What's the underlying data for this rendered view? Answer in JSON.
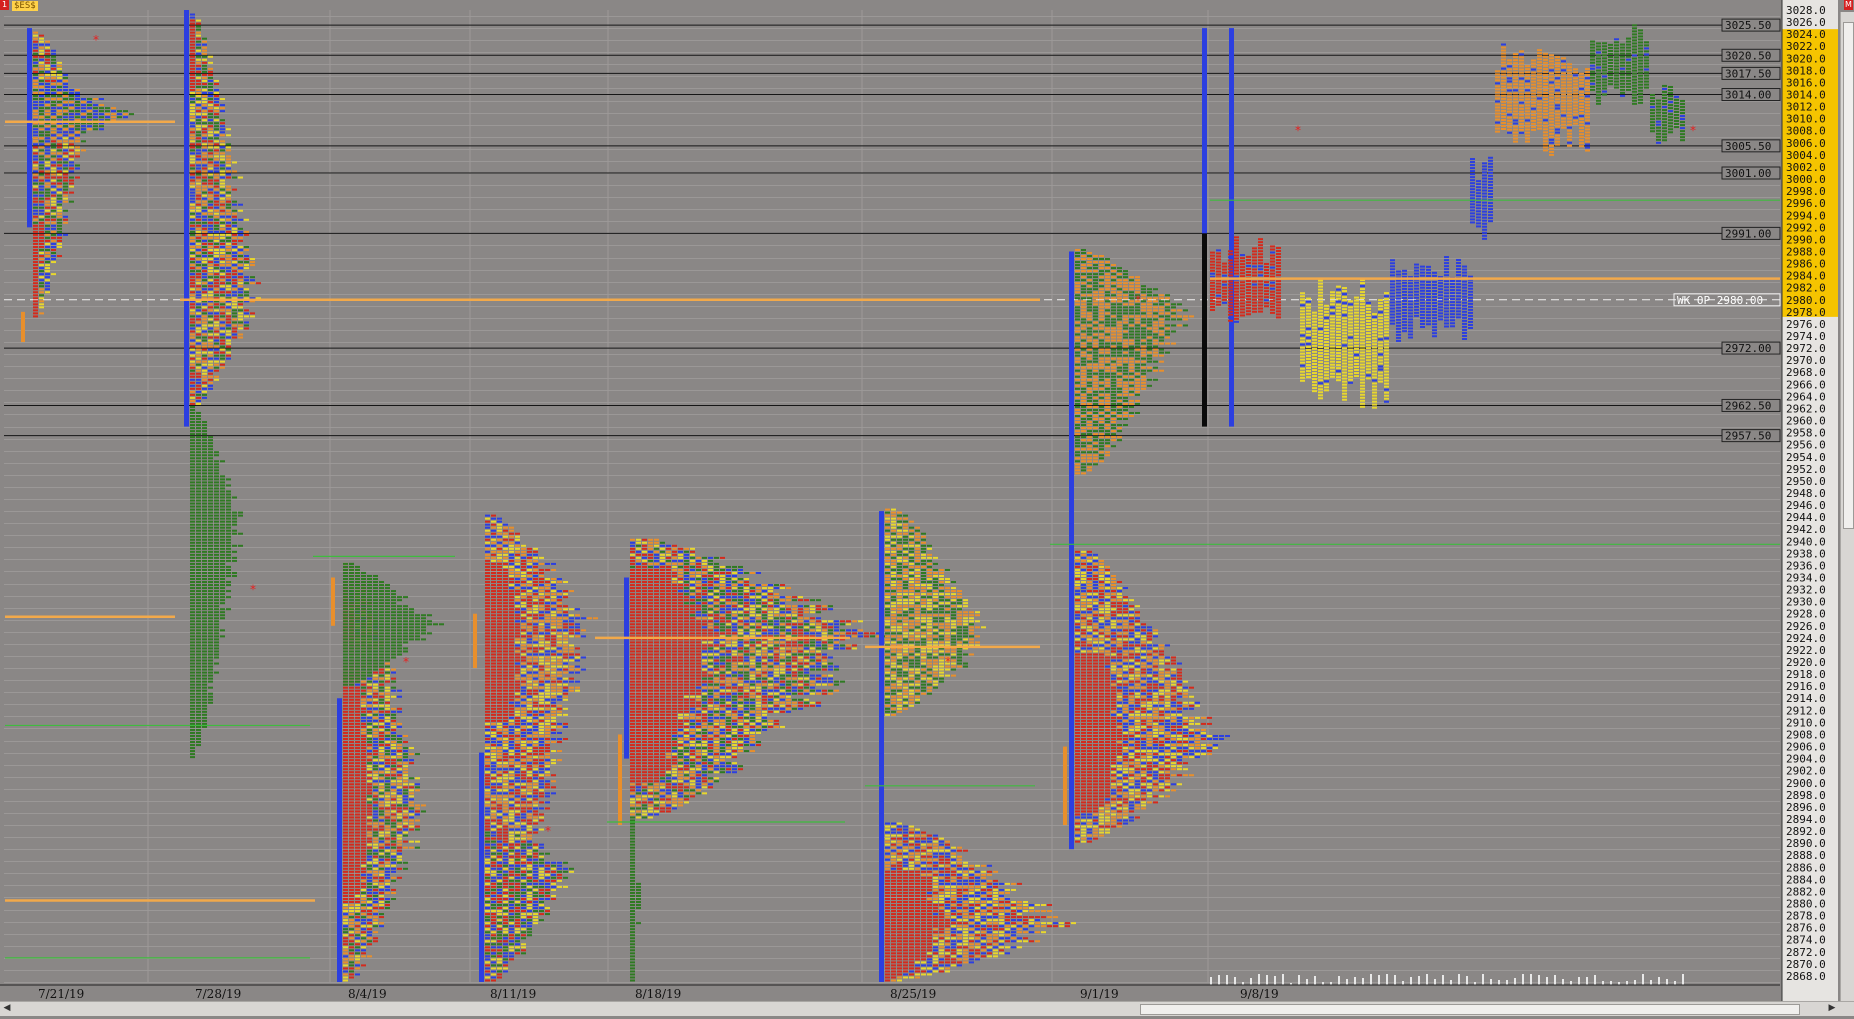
{
  "symbol": "$ES$",
  "corner_left": "1",
  "corner_right": "M",
  "chart_data": {
    "type": "market-profile",
    "x_label_dates": [
      "7/21/19",
      "7/28/19",
      "8/4/19",
      "8/11/19",
      "8/18/19",
      "8/25/19",
      "9/1/19",
      "9/8/19"
    ],
    "y_range": [
      2867,
      3028
    ],
    "y_tick_step": 2,
    "tick": 0.5,
    "row_step": 0.5,
    "colors": {
      "red": "#d42a1c",
      "orange": "#e88f2c",
      "yellow": "#e8d72e",
      "green": "#2f7a22",
      "blue": "#2c3fe0",
      "black": "#0a0a0a",
      "poc": "#f2a94a",
      "level_line": "#161616",
      "green_line": "#3fbb3f",
      "background": "#8a8786",
      "grid": "#9b9897",
      "axis_yellow": "#f5c400",
      "axis_bg": "#e6e4e1"
    },
    "price_labels": [
      {
        "price": 3025.5,
        "label": "3025.50"
      },
      {
        "price": 3020.5,
        "label": "3020.50"
      },
      {
        "price": 3017.5,
        "label": "3017.50"
      },
      {
        "price": 3014.0,
        "label": "3014.00"
      },
      {
        "price": 3005.5,
        "label": "3005.50"
      },
      {
        "price": 3001.0,
        "label": "3001.00"
      },
      {
        "price": 2991.0,
        "label": "2991.00"
      },
      {
        "price": 2980.0,
        "label": "WK OP 2980.00"
      },
      {
        "price": 2972.0,
        "label": "2972.00"
      },
      {
        "price": 2962.5,
        "label": "2962.50"
      },
      {
        "price": 2957.5,
        "label": "2957.50"
      }
    ],
    "axis_highlight": {
      "from": 2978,
      "to": 3024
    },
    "week_profiles": [
      {
        "date": "7/21/19",
        "blocks": [
          {
            "low": 2977,
            "high": 3024,
            "maxw": 55,
            "peak": 3010,
            "mix": [
              "green",
              "yellow",
              "orange",
              "blue",
              "red"
            ],
            "reds": [
              2977,
              2992
            ]
          },
          {
            "low": 3006,
            "high": 3016,
            "maxw": 100,
            "peak": 3010,
            "mix": [
              "green",
              "orange",
              "blue"
            ]
          }
        ],
        "initial_range": {
          "low": 2992,
          "high": 3025
        },
        "singles": [
          {
            "low": 2973,
            "high": 2978
          }
        ],
        "poc": 3009,
        "value_area": [
          2980,
          3022
        ],
        "star": 3023
      },
      {
        "date": "7/28/19",
        "blocks": [
          {
            "low": 2962,
            "high": 3027,
            "maxw": 65,
            "peak": 2980,
            "mix": [
              "orange",
              "yellow",
              "red",
              "blue",
              "green"
            ],
            "reds": [
              3015,
              3026
            ]
          },
          {
            "low": 2904,
            "high": 2962,
            "maxw": 50,
            "peak": 2943,
            "mix": [
              "green"
            ]
          }
        ],
        "initial_range": {
          "low": 2959,
          "high": 3028
        },
        "singles": [],
        "poc": 2980,
        "value_area": [
          2968,
          3024
        ],
        "star": 2932
      },
      {
        "date": "8/4/19",
        "blocks": [
          {
            "low": 2867,
            "high": 2936,
            "maxw": 80,
            "peak": 2895,
            "mix": [
              "red",
              "orange",
              "yellow",
              "blue",
              "green"
            ],
            "reds": [
              2880,
              2935
            ]
          },
          {
            "low": 2916,
            "high": 2936,
            "maxw": 90,
            "peak": 2926,
            "mix": [
              "green"
            ]
          }
        ],
        "initial_range": {
          "low": 2867,
          "high": 2914
        },
        "singles": [
          {
            "low": 2926,
            "high": 2934
          }
        ],
        "poc": 2926,
        "value_area": [
          2878,
          2932
        ],
        "star": 2920
      },
      {
        "date": "8/11/19",
        "blocks": [
          {
            "low": 2867,
            "high": 2944,
            "maxw": 100,
            "peak": 2927,
            "mix": [
              "yellow",
              "red",
              "blue",
              "orange"
            ],
            "reds": [
              2910,
              2936
            ]
          },
          {
            "low": 2867,
            "high": 2893,
            "maxw": 85,
            "peak": 2885,
            "mix": [
              "blue",
              "yellow",
              "green",
              "red"
            ]
          }
        ],
        "initial_range": {
          "low": 2867,
          "high": 2905
        },
        "singles": [
          {
            "low": 2919,
            "high": 2928
          }
        ],
        "poc": 2927,
        "value_area": [
          2870,
          2940
        ],
        "star": 2892
      },
      {
        "date": "8/18/19",
        "blocks": [
          {
            "low": 2894,
            "high": 2940,
            "maxw": 235,
            "peak": 2924,
            "mix": [
              "orange",
              "yellow",
              "red",
              "blue",
              "green"
            ],
            "reds": [
              2900,
              2935
            ]
          },
          {
            "low": 2867,
            "high": 2894,
            "maxw": 10,
            "peak": 2880,
            "mix": [
              "green"
            ]
          }
        ],
        "initial_range": {
          "low": 2904,
          "high": 2934
        },
        "singles": [
          {
            "low": 2893,
            "high": 2908
          }
        ],
        "poc": 2924,
        "value_area": [
          2898,
          2935
        ],
        "star": null
      },
      {
        "date": "8/25/19",
        "blocks": [
          {
            "low": 2911,
            "high": 2945,
            "maxw": 100,
            "peak": 2923,
            "mix": [
              "green",
              "orange",
              "yellow"
            ]
          },
          {
            "low": 2867,
            "high": 2893,
            "maxw": 175,
            "peak": 2876,
            "mix": [
              "red",
              "yellow",
              "orange",
              "blue"
            ],
            "reds": [
              2867,
              2885
            ]
          }
        ],
        "initial_range": {
          "low": 2867,
          "high": 2945
        },
        "singles": [],
        "poc": 2922,
        "value_area": [
          2875,
          2940
        ],
        "star": 2920
      },
      {
        "date": "9/1/19",
        "blocks": [
          {
            "low": 2951,
            "high": 2988,
            "maxw": 110,
            "peak": 2978,
            "mix": [
              "green",
              "orange"
            ]
          },
          {
            "low": 2890,
            "high": 2938,
            "maxw": 140,
            "peak": 2906,
            "mix": [
              "blue",
              "red",
              "yellow",
              "orange"
            ],
            "reds": [
              2895,
              2921
            ]
          }
        ],
        "initial_range": {
          "low": 2889,
          "high": 2988
        },
        "singles": [
          {
            "low": 2893,
            "high": 2906
          }
        ],
        "poc": 2978,
        "value_area": [
          2900,
          2985
        ],
        "star": 2980
      },
      {
        "date": "9/8/19",
        "blocks": [],
        "initial_range": {
          "low": 2959,
          "high": 3025
        },
        "singles": [],
        "poc": 2983,
        "value_area": [
          2972,
          3021
        ],
        "star": 3008
      }
    ],
    "current_week_tpo": [
      {
        "price_low": 2975,
        "price_high": 2991,
        "color": "red",
        "x0": 1210,
        "x1": 1280
      },
      {
        "price_low": 2962,
        "price_high": 2984,
        "color": "yellow",
        "x0": 1300,
        "x1": 1390
      },
      {
        "price_low": 2973,
        "price_high": 2988,
        "color": "blue",
        "x0": 1390,
        "x1": 1470
      },
      {
        "price_low": 2990,
        "price_high": 3004,
        "color": "blue",
        "x0": 1470,
        "x1": 1490
      },
      {
        "price_low": 3004,
        "price_high": 3023,
        "color": "orange",
        "x0": 1495,
        "x1": 1590
      },
      {
        "price_low": 3012,
        "price_high": 3026,
        "color": "green",
        "x0": 1590,
        "x1": 1650
      },
      {
        "price_low": 3006,
        "price_high": 3016,
        "color": "green",
        "x0": 1650,
        "x1": 1685
      }
    ],
    "green_lines": [
      {
        "price": 2996.5,
        "from": 1210,
        "to": 1780
      },
      {
        "price": 2939.5,
        "from": 1050,
        "to": 1780
      },
      {
        "price": 2937.5,
        "from": 313,
        "to": 455
      },
      {
        "price": 2909.5,
        "from": 5,
        "to": 310
      },
      {
        "price": 2899.5,
        "from": 865,
        "to": 1035
      },
      {
        "price": 2893.5,
        "from": 607,
        "to": 845
      },
      {
        "price": 2871.0,
        "from": 5,
        "to": 310
      }
    ],
    "orange_lines": [
      {
        "price": 2983.5,
        "from": 1210,
        "to": 1780
      },
      {
        "price": 2980.0,
        "from": 180,
        "to": 1040
      },
      {
        "price": 3009.5,
        "from": 5,
        "to": 175
      },
      {
        "price": 2927.5,
        "from": 5,
        "to": 175
      },
      {
        "price": 2880.5,
        "from": 5,
        "to": 315
      },
      {
        "price": 2924.0,
        "from": 595,
        "to": 850
      },
      {
        "price": 2922.5,
        "from": 865,
        "to": 1040
      }
    ]
  }
}
